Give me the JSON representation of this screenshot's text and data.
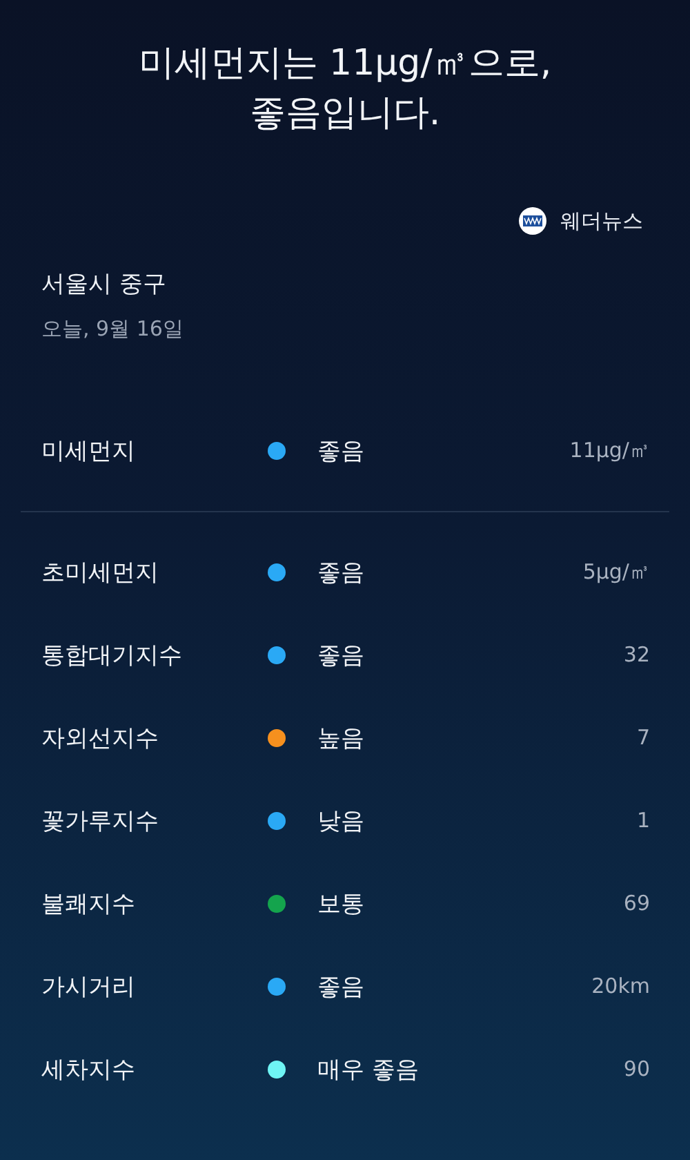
{
  "headline": [
    "미세먼지는 11μg/㎥으로,",
    "좋음입니다."
  ],
  "source": {
    "name": "웨더뉴스"
  },
  "location": "서울시 중구",
  "date": "오늘,   9월 16일",
  "primary": {
    "name": "미세먼지",
    "status": "좋음",
    "color": "#2aa9f5",
    "value": "11μg/㎥"
  },
  "indices": [
    {
      "name": "초미세먼지",
      "status": "좋음",
      "color": "#2aa9f5",
      "value": "5μg/㎥"
    },
    {
      "name": "통합대기지수",
      "status": "좋음",
      "color": "#2aa9f5",
      "value": "32"
    },
    {
      "name": "자외선지수",
      "status": "높음",
      "color": "#f6901e",
      "value": "7"
    },
    {
      "name": "꽃가루지수",
      "status": "낮음",
      "color": "#2aa9f5",
      "value": "1"
    },
    {
      "name": "불쾌지수",
      "status": "보통",
      "color": "#14a44d",
      "value": "69"
    },
    {
      "name": "가시거리",
      "status": "좋음",
      "color": "#2aa9f5",
      "value": "20km"
    },
    {
      "name": "세차지수",
      "status": "매우 좋음",
      "color": "#6ff5f5",
      "value": "90"
    }
  ]
}
